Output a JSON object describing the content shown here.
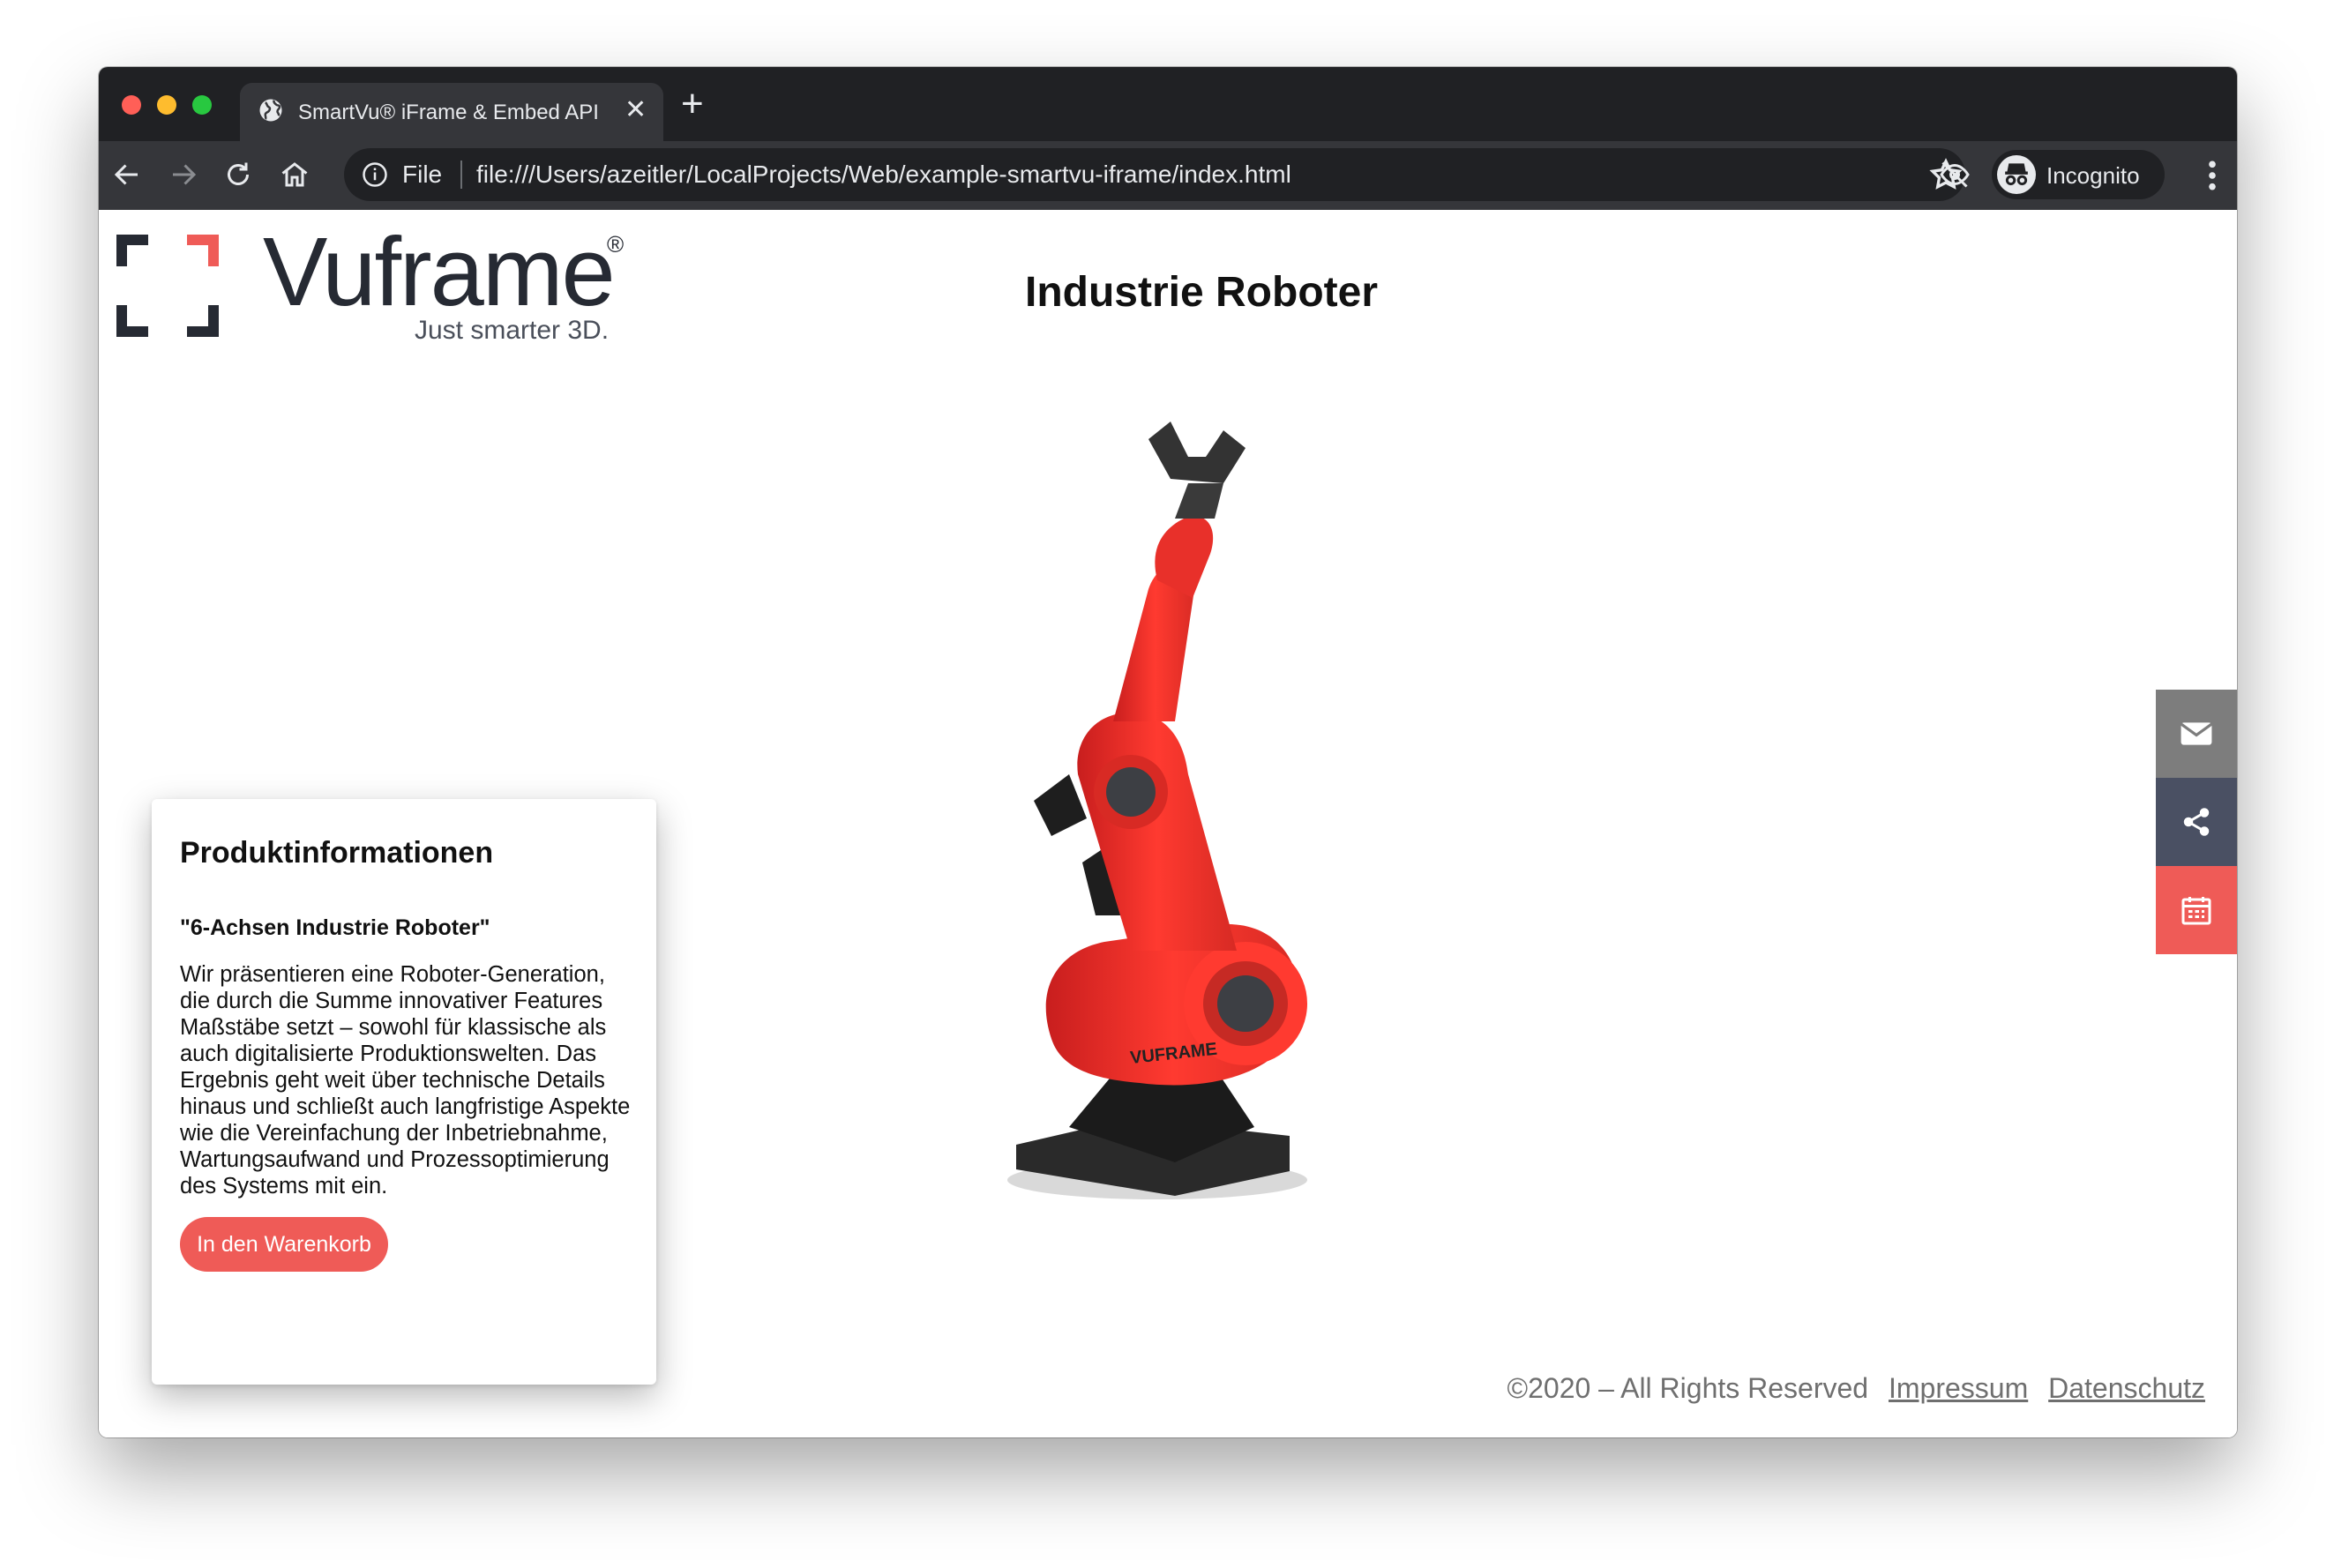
{
  "browser": {
    "tab_title": "SmartVu® iFrame & Embed API",
    "tab_close": "✕",
    "new_tab": "+",
    "scheme_label": "File",
    "url": "file:///Users/azeitler/LocalProjects/Web/example-smartvu-iframe/index.html",
    "profile_label": "Incognito",
    "traffic_lights": [
      "#ff5f57",
      "#febc2e",
      "#28c840"
    ],
    "icons": [
      "back-icon",
      "forward-icon",
      "reload-icon",
      "home-icon",
      "info-icon",
      "eye-off-icon",
      "star-icon",
      "incognito-icon",
      "more-vert-icon"
    ]
  },
  "page": {
    "logo": {
      "brand": "Vuframe",
      "registered": "®",
      "tagline": "Just smarter 3D."
    },
    "title": "Industrie Roboter",
    "product_card": {
      "heading": "Produktinformationen",
      "subheading": "\"6-Achsen Industrie Roboter\"",
      "description": "Wir präsentieren eine Roboter-Generation, die durch die Summe innovativer Features Maßstäbe setzt – sowohl für klassische als auch digitalisierte Produktionswelten. Das Ergebnis geht weit über technische Details hinaus und schließt auch langfristige Aspekte wie die Vereinfachung der Inbetriebnahme, Wartungsaufwand und Prozessoptimierung des Systems mit ein.",
      "button": "In den Warenkorb"
    },
    "model_label": "VUFRAME",
    "side_buttons": [
      {
        "icon": "mail-icon",
        "color": "#7d7d7d"
      },
      {
        "icon": "share-icon",
        "color": "#4a5063"
      },
      {
        "icon": "calendar-icon",
        "color": "#ef5b57"
      }
    ],
    "footer": {
      "copyright": "©2020 – All Rights Reserved",
      "impressum": "Impressum",
      "datenschutz": "Datenschutz"
    },
    "accent_color": "#ef5b57"
  }
}
